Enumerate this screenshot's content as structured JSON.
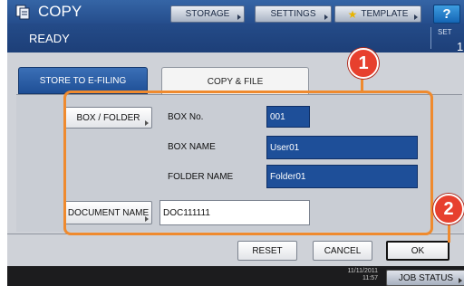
{
  "header": {
    "title": "COPY",
    "status": "READY",
    "set_label": "SET",
    "set_value": "1",
    "storage_label": "STORAGE",
    "settings_label": "SETTINGS",
    "template_label": "TEMPLATE",
    "help_label": "?"
  },
  "tabs": [
    {
      "label": "STORE TO E-FILING",
      "active": false
    },
    {
      "label": "COPY & FILE",
      "active": true
    }
  ],
  "form": {
    "box_folder_button": "BOX / FOLDER",
    "box_no_label": "BOX No.",
    "box_no_value": "001",
    "box_name_label": "BOX NAME",
    "box_name_value": "User01",
    "folder_name_label": "FOLDER NAME",
    "folder_name_value": "Folder01",
    "document_name_button": "DOCUMENT NAME",
    "document_name_value": "DOC111111"
  },
  "actions": {
    "reset": "RESET",
    "cancel": "CANCEL",
    "ok": "OK"
  },
  "callouts": {
    "one": "1",
    "two": "2"
  },
  "footer": {
    "date": "11/11/2011",
    "time": "11:57",
    "job_status": "JOB STATUS"
  },
  "colors": {
    "header_blue": "#1d3f78",
    "field_blue": "#1e4f99",
    "highlight_orange": "#ef8a2e",
    "badge_red": "#e7402e"
  }
}
